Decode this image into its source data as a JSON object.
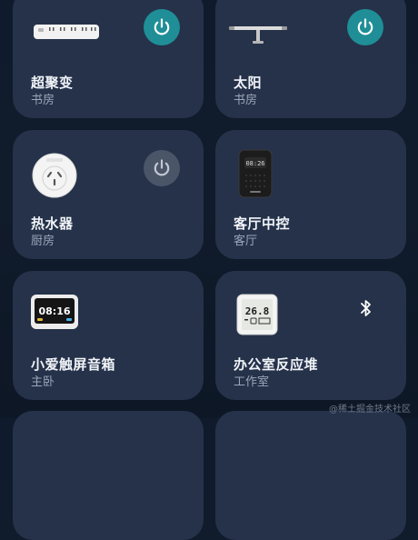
{
  "devices": [
    {
      "name": "超聚变",
      "room": "书房",
      "icon": "power-strip-icon",
      "control": "power",
      "power_state": "on"
    },
    {
      "name": "太阳",
      "room": "书房",
      "icon": "monitor-light-bar-icon",
      "control": "power",
      "power_state": "on"
    },
    {
      "name": "热水器",
      "room": "厨房",
      "icon": "smart-plug-icon",
      "control": "power",
      "power_state": "off"
    },
    {
      "name": "客厅中控",
      "room": "客厅",
      "icon": "smart-speaker-icon",
      "screen_time": "08:26",
      "control": "none"
    },
    {
      "name": "小爱触屏音箱",
      "room": "主卧",
      "icon": "touchscreen-speaker-icon",
      "screen_time": "08:16",
      "control": "none"
    },
    {
      "name": "办公室反应堆",
      "room": "工作室",
      "icon": "thermo-hygrometer-icon",
      "screen_reading": "26.8",
      "control": "bluetooth"
    }
  ],
  "watermark": "@稀土掘金技术社区",
  "colors": {
    "background": "#0f1b2c",
    "card": "#25324a",
    "power_on": "#1f8e97",
    "power_off": "#4b5568",
    "text_primary": "#f1f4f8",
    "text_secondary": "#9aa6b8"
  }
}
